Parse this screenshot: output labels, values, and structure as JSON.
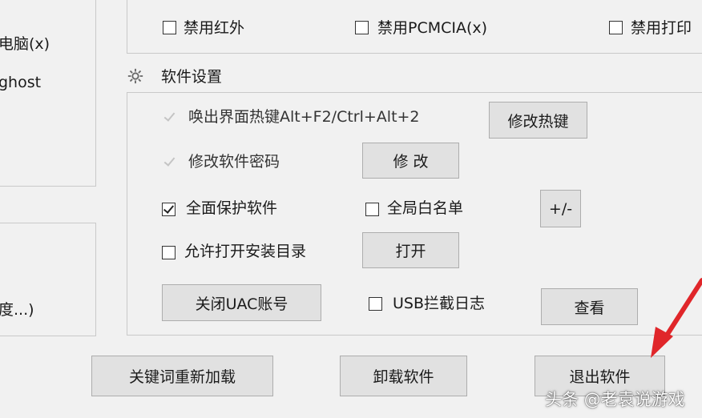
{
  "left_panel": {
    "item_computer": "电脑(x)",
    "item_ghost": "ghost",
    "item_partial": "度...)"
  },
  "top_group": {
    "checkbox_disable_infrared": "禁用红外",
    "checkbox_disable_pcmcia": "禁用PCMCIA(x)",
    "checkbox_disable_print": "禁用打印"
  },
  "software_settings": {
    "section_title": "软件设置",
    "hotkey_label": "唤出界面热键Alt+F2/Ctrl+Alt+2",
    "hotkey_button": "修改热键",
    "password_label": "修改软件密码",
    "password_button": "修 改",
    "full_protect_label": "全面保护软件",
    "whitelist_label": "全局白名单",
    "whitelist_button": "+/-",
    "allow_open_dir_label": "允许打开安装目录",
    "open_button": "打开",
    "uac_button": "关闭UAC账号",
    "usb_log_label": "USB拦截日志",
    "view_button": "查看"
  },
  "footer": {
    "reload_keywords_button": "关键词重新加载",
    "uninstall_button": "卸载软件",
    "exit_button": "退出软件"
  },
  "watermark": "头条 @老袁说游戏",
  "colors": {
    "window_bg": "#f1f1f1",
    "button_bg": "#e1e1e1",
    "arrow": "#e0262a"
  },
  "states": {
    "hotkey_checked": true,
    "hotkey_disabled": true,
    "password_checked": true,
    "password_disabled": true,
    "full_protect_checked": true,
    "whitelist_checked": false,
    "allow_open_dir_checked": false,
    "usb_log_checked": false,
    "disable_infrared_checked": false,
    "disable_pcmcia_checked": false,
    "disable_print_checked": false
  }
}
